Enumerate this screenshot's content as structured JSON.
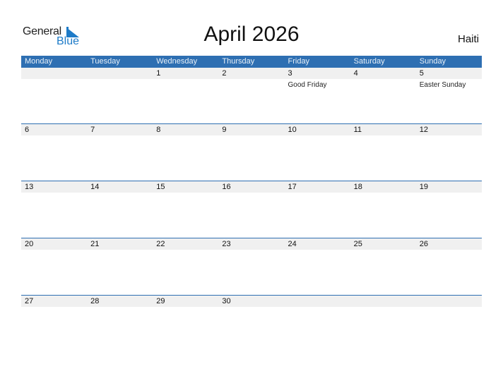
{
  "logo": {
    "word1": "General",
    "word2": "Blue",
    "icon": "triangle-flag-icon"
  },
  "title": "April 2026",
  "country": "Haiti",
  "colors": {
    "accent": "#2e6fb2",
    "logo_blue": "#1e7bc8",
    "date_strip": "#f0f0f0"
  },
  "weekdays": [
    "Monday",
    "Tuesday",
    "Wednesday",
    "Thursday",
    "Friday",
    "Saturday",
    "Sunday"
  ],
  "weeks": [
    {
      "days": [
        {
          "date": "",
          "holiday": ""
        },
        {
          "date": "",
          "holiday": ""
        },
        {
          "date": "1",
          "holiday": ""
        },
        {
          "date": "2",
          "holiday": ""
        },
        {
          "date": "3",
          "holiday": "Good Friday"
        },
        {
          "date": "4",
          "holiday": ""
        },
        {
          "date": "5",
          "holiday": "Easter Sunday"
        }
      ]
    },
    {
      "days": [
        {
          "date": "6",
          "holiday": ""
        },
        {
          "date": "7",
          "holiday": ""
        },
        {
          "date": "8",
          "holiday": ""
        },
        {
          "date": "9",
          "holiday": ""
        },
        {
          "date": "10",
          "holiday": ""
        },
        {
          "date": "11",
          "holiday": ""
        },
        {
          "date": "12",
          "holiday": ""
        }
      ]
    },
    {
      "days": [
        {
          "date": "13",
          "holiday": ""
        },
        {
          "date": "14",
          "holiday": ""
        },
        {
          "date": "15",
          "holiday": ""
        },
        {
          "date": "16",
          "holiday": ""
        },
        {
          "date": "17",
          "holiday": ""
        },
        {
          "date": "18",
          "holiday": ""
        },
        {
          "date": "19",
          "holiday": ""
        }
      ]
    },
    {
      "days": [
        {
          "date": "20",
          "holiday": ""
        },
        {
          "date": "21",
          "holiday": ""
        },
        {
          "date": "22",
          "holiday": ""
        },
        {
          "date": "23",
          "holiday": ""
        },
        {
          "date": "24",
          "holiday": ""
        },
        {
          "date": "25",
          "holiday": ""
        },
        {
          "date": "26",
          "holiday": ""
        }
      ]
    },
    {
      "days": [
        {
          "date": "27",
          "holiday": ""
        },
        {
          "date": "28",
          "holiday": ""
        },
        {
          "date": "29",
          "holiday": ""
        },
        {
          "date": "30",
          "holiday": ""
        },
        {
          "date": "",
          "holiday": ""
        },
        {
          "date": "",
          "holiday": ""
        },
        {
          "date": "",
          "holiday": ""
        }
      ]
    }
  ]
}
